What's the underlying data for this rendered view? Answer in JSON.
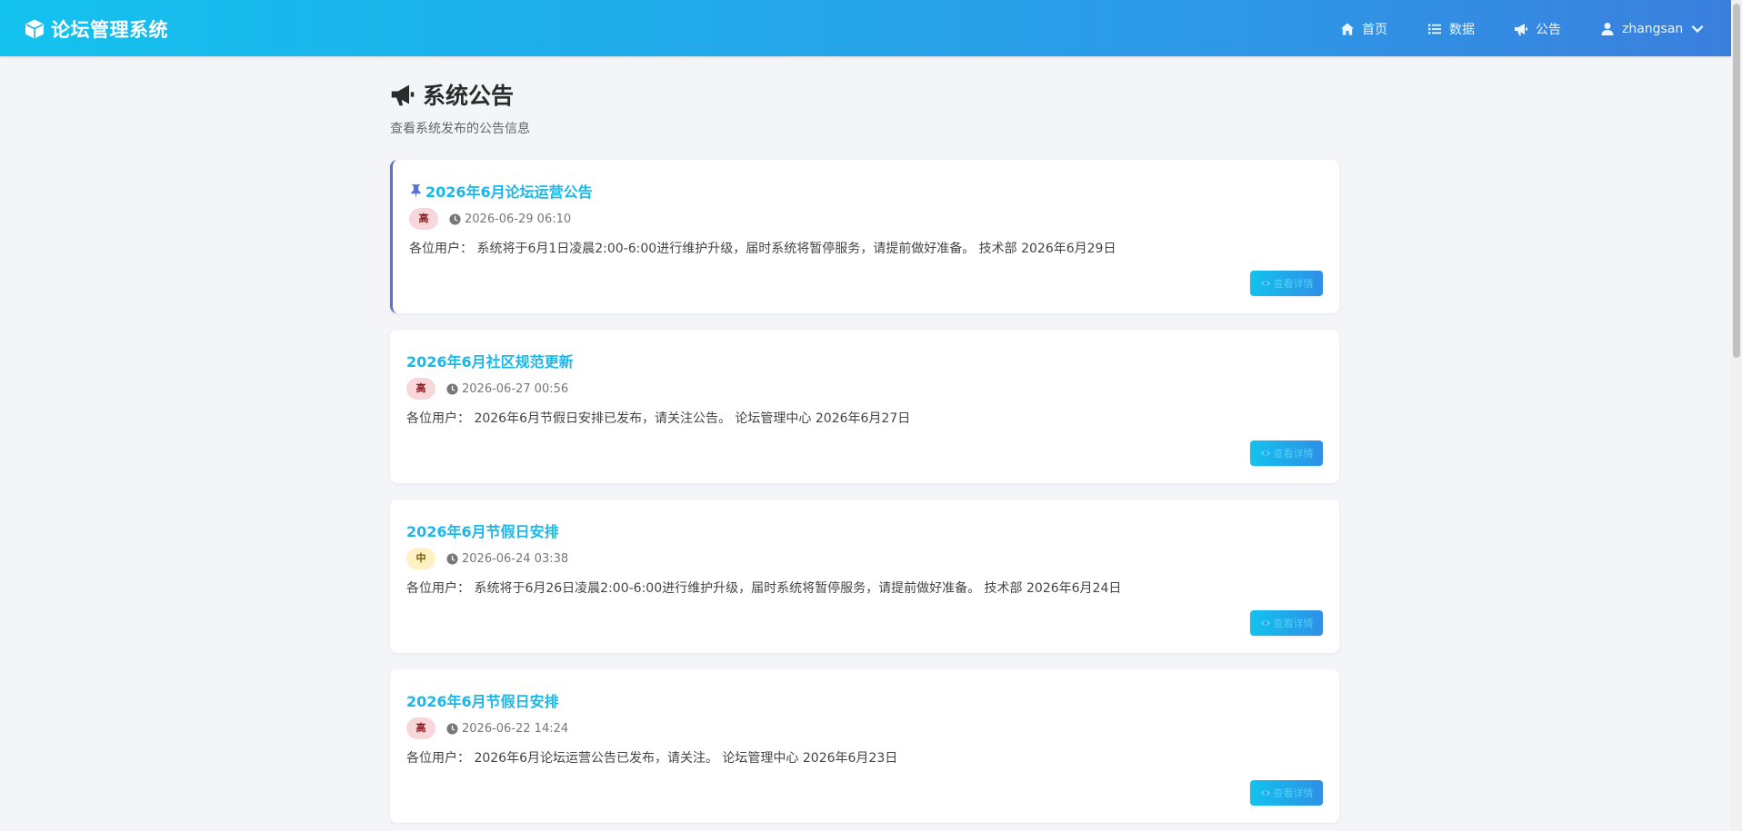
{
  "navbar": {
    "brand": "论坛管理系统",
    "home": "首页",
    "data": "数据",
    "notice": "公告",
    "user": "zhangsan"
  },
  "page": {
    "title": "系统公告",
    "subtitle": "查看系统发布的公告信息"
  },
  "announcements": [
    {
      "title": "2026年6月论坛运营公告",
      "pinned": true,
      "priority": "高",
      "time": "2026-06-29 06:10",
      "content": "各位用户： 系统将于6月1日凌晨2:00-6:00进行维护升级，届时系统将暂停服务，请提前做好准备。 技术部 2026年6月29日",
      "button": "查看详情"
    },
    {
      "title": "2026年6月社区规范更新",
      "pinned": false,
      "priority": "高",
      "time": "2026-06-27 00:56",
      "content": "各位用户： 2026年6月节假日安排已发布，请关注公告。 论坛管理中心 2026年6月27日",
      "button": "查看详情"
    },
    {
      "title": "2026年6月节假日安排",
      "pinned": false,
      "priority": "中",
      "time": "2026-06-24 03:38",
      "content": "各位用户： 系统将于6月26日凌晨2:00-6:00进行维护升级，届时系统将暂停服务，请提前做好准备。 技术部 2026年6月24日",
      "button": "查看详情"
    },
    {
      "title": "2026年6月节假日安排",
      "pinned": false,
      "priority": "高",
      "time": "2026-06-22 14:24",
      "content": "各位用户： 2026年6月论坛运营公告已发布，请关注。 论坛管理中心 2026年6月23日",
      "button": "查看详情"
    }
  ],
  "colors": {
    "accent": "#19b8e8",
    "pinned_border": "#5b6fd8",
    "badge_high_bg": "#f8d7da",
    "badge_mid_bg": "#fff1c4"
  }
}
